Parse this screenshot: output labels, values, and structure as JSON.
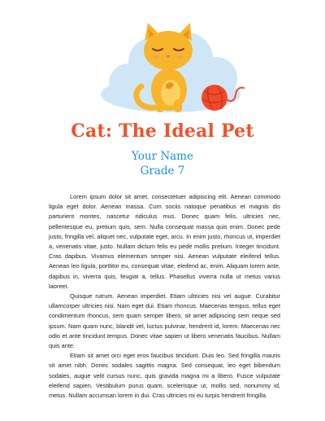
{
  "document": {
    "title": "Cat: The Ideal Pet",
    "author_name": "Your Name",
    "grade": "Grade 7",
    "paragraphs": [
      "Lorem ipsum dolor sit amet, consectetuer adipiscing elit. Aenean commodo ligula eget dolor. Aenean massa. Cum sociis natoque penatibus et magnis dis parturient montes, nascetur ridiculus mus. Donec quam felis, ultricies nec, pellentesque eu, pretium quis, sem. Nulla consequat massa quis enim. Donec pede justo, fringilla vel, aliquet nec, vulputate eget, arcu. In enim justo, rhoncus ut, imperdiet a, venenatis vitae, justo. Nullam dictum felis eu pede mollis pretium. Integer tincidunt. Cras dapibus. Vivamus elementum semper nisi. Aenean vulputate eleifend tellus. Aenean leo ligula, porttitor eu, consequat vitae, eleifend ac, enim. Aliquam lorem ante, dapibus in, viverra quis, feugiat a, tellus. Phasellus viverra nulla ut metus varius laoreet.",
      "Quisque rutrum. Aenean imperdiet. Etiam ultricies nisi vel augue. Curabitur ullamcorper ultricies nisi. Nam eget dui. Etiam rhoncus. Maecenas tempus, tellus eget condimentum rhoncus, sem quam semper libero, sit amet adipiscing sem neque sed ipsum. Nam quam nunc, blandit vel, luctus pulvinar, hendrerit id, lorem. Maecenas nec odio et ante tincidunt tempus. Donec vitae sapien ut libero venenatis faucibus. Nullam quis ante.",
      "Etiam sit amet orci eget eros faucibus tincidunt. Duis leo. Sed fringilla mauris sit amet nibh. Donec sodales sagittis magna. Sed consequat, leo eget bibendum sodales, augue velit cursus nunc, quis gravida magna mi a libero. Fusce vulputate eleifend sapien. Vestibulum purus quam, scelerisque ut, mollis sed, nonummy id, metus. Nullam accumsan lorem in dui. Cras ultricies mi eu turpis hendrerit fringilla."
    ]
  },
  "colors": {
    "title": "#f0532b",
    "author": "#1f91d6",
    "cloud": "#cfe6f7",
    "cat_fur": "#f7b52c",
    "cat_shadow": "#e8941a",
    "yarn": "#f04a2a"
  },
  "icons": {
    "illustration": "cat-with-yarn-ball-illustration"
  }
}
